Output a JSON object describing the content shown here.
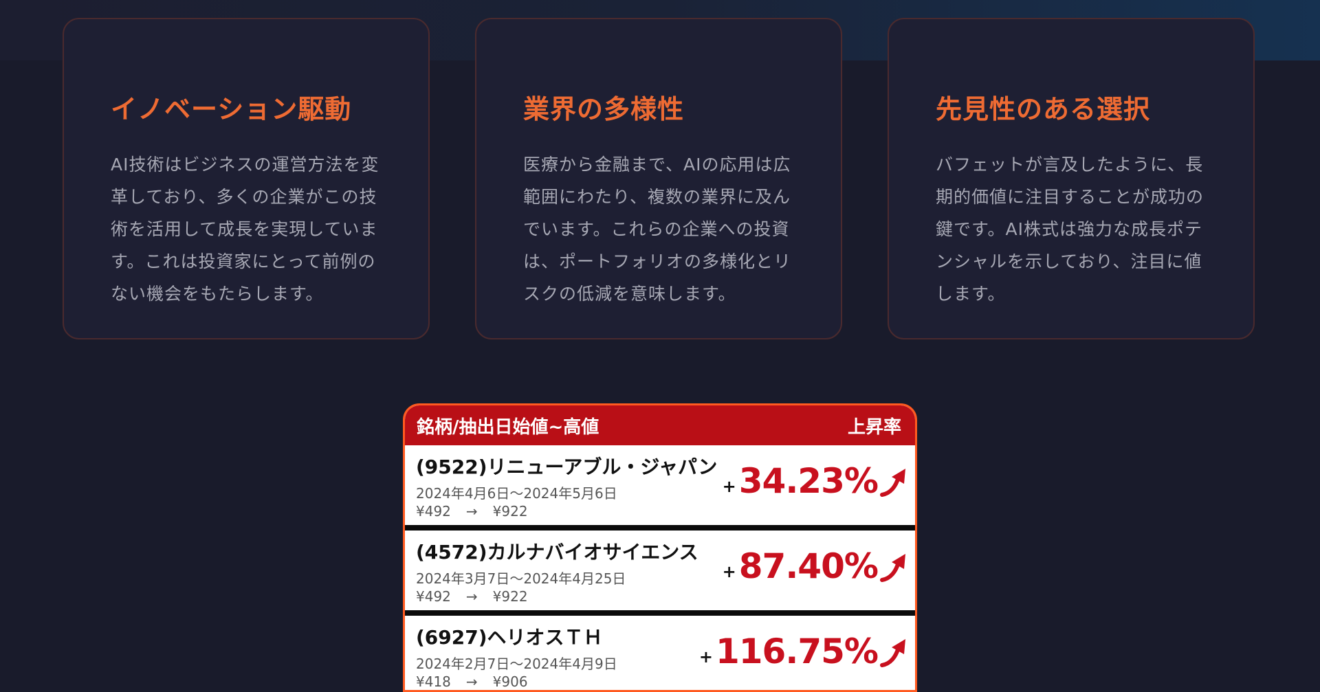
{
  "cards": [
    {
      "title": "イノベーション駆動",
      "body": "AI技術はビジネスの運営方法を変革しており、多くの企業がこの技術を活用して成長を実現しています。これは投資家にとって前例のない機会をもたらします。"
    },
    {
      "title": "業界の多様性",
      "body": "医療から金融まで、AIの応用は広範囲にわたり、複数の業界に及んでいます。これらの企業への投資は、ポートフォリオの多様化とリスクの低減を意味します。"
    },
    {
      "title": "先見性のある選択",
      "body": "バフェットが言及したように、長期的価値に注目することが成功の鍵です。AI株式は強力な成長ポテンシャルを示しており、注目に値します。"
    }
  ],
  "table": {
    "header_left": "銘柄/抽出日始値~高値",
    "header_right": "上昇率",
    "rows": [
      {
        "name": "(9522)リニューアブル・ジャパン",
        "dates": "2024年4月6日〜2024年5月6日",
        "price_from": "¥492",
        "arrow": "→",
        "price_to": "¥922",
        "plus": "+",
        "rate": "34.23%"
      },
      {
        "name": "(4572)カルナバイオサイエンス",
        "dates": "2024年3月7日〜2024年4月25日",
        "price_from": "¥492",
        "arrow": "→",
        "price_to": "¥922",
        "plus": "+",
        "rate": "87.40%"
      },
      {
        "name": "(6927)ヘリオスＴＨ",
        "dates": "2024年2月7日〜2024年4月9日",
        "price_from": "¥418",
        "arrow": "→",
        "price_to": "¥906",
        "plus": "+",
        "rate": "116.75%"
      }
    ]
  },
  "colors": {
    "accent_orange": "#ee6b33",
    "table_header_red": "#b90f16",
    "rate_red": "#c8101e",
    "background": "#191b2b"
  },
  "icons": {
    "rate_icon": "trend-up-arrow-icon"
  }
}
